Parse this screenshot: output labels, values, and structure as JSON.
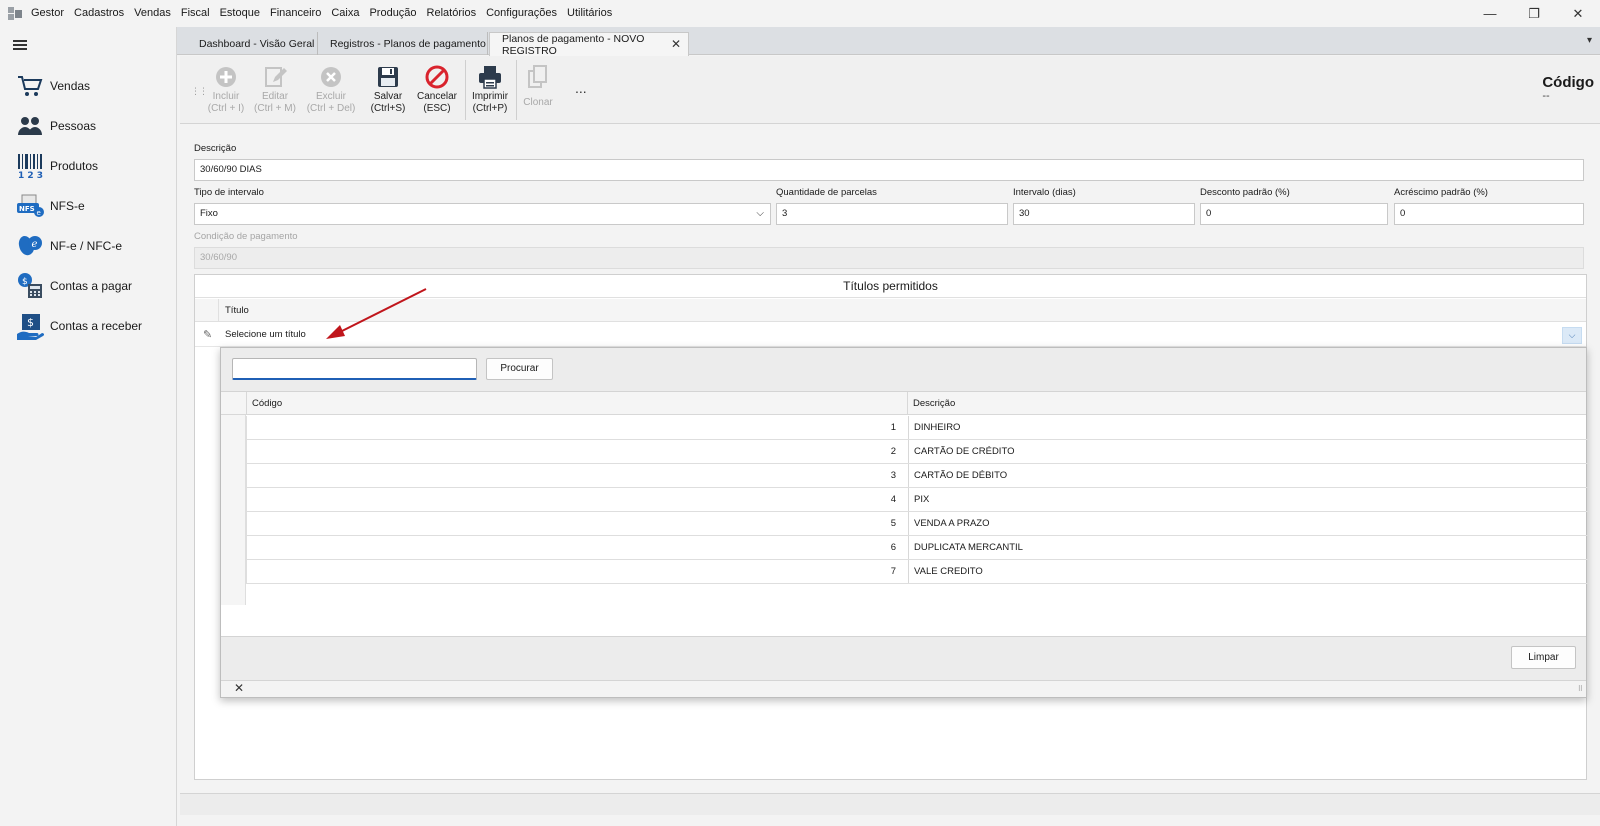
{
  "menubar": {
    "items": [
      "Gestor",
      "Cadastros",
      "Vendas",
      "Fiscal",
      "Estoque",
      "Financeiro",
      "Caixa",
      "Produção",
      "Relatórios",
      "Configurações",
      "Utilitários"
    ],
    "min": "—",
    "restore": "❐",
    "close": "✕"
  },
  "sidebar": {
    "items": [
      {
        "label": "Vendas",
        "icon": "cart-icon"
      },
      {
        "label": "Pessoas",
        "icon": "people-icon"
      },
      {
        "label": "Produtos",
        "icon": "barcode-icon"
      },
      {
        "label": "NFS-e",
        "icon": "nfse-icon"
      },
      {
        "label": "NF-e / NFC-e",
        "icon": "nfe-icon"
      },
      {
        "label": "Contas a pagar",
        "icon": "bills-icon"
      },
      {
        "label": "Contas a receber",
        "icon": "receivable-icon"
      }
    ]
  },
  "tabs": [
    {
      "label": "Dashboard - Visão Geral",
      "active": false
    },
    {
      "label": "Registros - Planos de pagamento",
      "active": false
    },
    {
      "label": "Planos de pagamento - NOVO REGISTRO",
      "active": true
    }
  ],
  "toolbar": {
    "incluir": {
      "line1": "Incluir",
      "line2": "(Ctrl + I)"
    },
    "editar": {
      "line1": "Editar",
      "line2": "(Ctrl + M)"
    },
    "excluir": {
      "line1": "Excluir",
      "line2": "(Ctrl + Del)"
    },
    "salvar": {
      "line1": "Salvar",
      "line2": "(Ctrl+S)"
    },
    "cancelar": {
      "line1": "Cancelar",
      "line2": "(ESC)"
    },
    "imprimir": {
      "line1": "Imprimir",
      "line2": "(Ctrl+P)"
    },
    "clonar": {
      "line1": "Clonar"
    },
    "more": "...",
    "codigo_label": "Código",
    "codigo_value": "--"
  },
  "form": {
    "descricao_label": "Descrição",
    "descricao_value": "30/60/90 DIAS",
    "tipo_label": "Tipo de intervalo",
    "tipo_value": "Fixo",
    "parcelas_label": "Quantidade de parcelas",
    "parcelas_value": "3",
    "intervalo_label": "Intervalo (dias)",
    "intervalo_value": "30",
    "desconto_label": "Desconto padrão (%)",
    "desconto_value": "0",
    "acrescimo_label": "Acréscimo padrão (%)",
    "acrescimo_value": "0",
    "condicao_label": "Condição de pagamento",
    "condicao_value": "30/60/90"
  },
  "titulos": {
    "panel_title": "Títulos permitidos",
    "column_header": "Título",
    "editor_placeholder": "Selecione um título"
  },
  "popup": {
    "search_value": "",
    "search_button": "Procurar",
    "col_codigo": "Código",
    "col_descricao": "Descrição",
    "rows": [
      {
        "codigo": "1",
        "descricao": "DINHEIRO"
      },
      {
        "codigo": "2",
        "descricao": "CARTÃO DE CRÉDITO"
      },
      {
        "codigo": "3",
        "descricao": "CARTÃO DE DÉBITO"
      },
      {
        "codigo": "4",
        "descricao": "PIX"
      },
      {
        "codigo": "5",
        "descricao": "VENDA A PRAZO"
      },
      {
        "codigo": "6",
        "descricao": "DUPLICATA MERCANTIL"
      },
      {
        "codigo": "7",
        "descricao": "VALE CREDITO"
      }
    ],
    "clear_button": "Limpar",
    "close_glyph": "✕"
  },
  "colors": {
    "arrow": "#c0151b",
    "cancel_red": "#d9232d",
    "accent_blue": "#1f5fb5"
  }
}
